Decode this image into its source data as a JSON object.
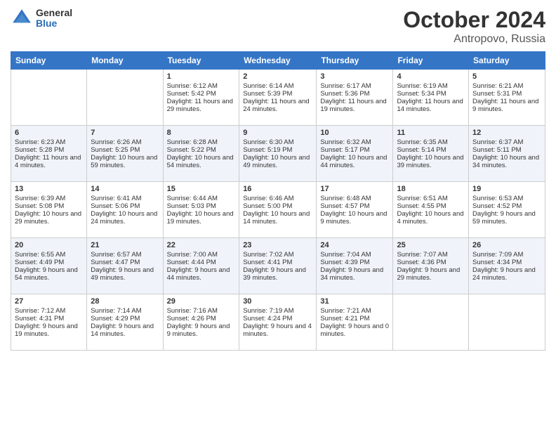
{
  "logo": {
    "general": "General",
    "blue": "Blue"
  },
  "title": {
    "month": "October 2024",
    "location": "Antropovo, Russia"
  },
  "headers": [
    "Sunday",
    "Monday",
    "Tuesday",
    "Wednesday",
    "Thursday",
    "Friday",
    "Saturday"
  ],
  "weeks": [
    [
      {
        "day": "",
        "sunrise": "",
        "sunset": "",
        "daylight": ""
      },
      {
        "day": "",
        "sunrise": "",
        "sunset": "",
        "daylight": ""
      },
      {
        "day": "1",
        "sunrise": "Sunrise: 6:12 AM",
        "sunset": "Sunset: 5:42 PM",
        "daylight": "Daylight: 11 hours and 29 minutes."
      },
      {
        "day": "2",
        "sunrise": "Sunrise: 6:14 AM",
        "sunset": "Sunset: 5:39 PM",
        "daylight": "Daylight: 11 hours and 24 minutes."
      },
      {
        "day": "3",
        "sunrise": "Sunrise: 6:17 AM",
        "sunset": "Sunset: 5:36 PM",
        "daylight": "Daylight: 11 hours and 19 minutes."
      },
      {
        "day": "4",
        "sunrise": "Sunrise: 6:19 AM",
        "sunset": "Sunset: 5:34 PM",
        "daylight": "Daylight: 11 hours and 14 minutes."
      },
      {
        "day": "5",
        "sunrise": "Sunrise: 6:21 AM",
        "sunset": "Sunset: 5:31 PM",
        "daylight": "Daylight: 11 hours and 9 minutes."
      }
    ],
    [
      {
        "day": "6",
        "sunrise": "Sunrise: 6:23 AM",
        "sunset": "Sunset: 5:28 PM",
        "daylight": "Daylight: 11 hours and 4 minutes."
      },
      {
        "day": "7",
        "sunrise": "Sunrise: 6:26 AM",
        "sunset": "Sunset: 5:25 PM",
        "daylight": "Daylight: 10 hours and 59 minutes."
      },
      {
        "day": "8",
        "sunrise": "Sunrise: 6:28 AM",
        "sunset": "Sunset: 5:22 PM",
        "daylight": "Daylight: 10 hours and 54 minutes."
      },
      {
        "day": "9",
        "sunrise": "Sunrise: 6:30 AM",
        "sunset": "Sunset: 5:19 PM",
        "daylight": "Daylight: 10 hours and 49 minutes."
      },
      {
        "day": "10",
        "sunrise": "Sunrise: 6:32 AM",
        "sunset": "Sunset: 5:17 PM",
        "daylight": "Daylight: 10 hours and 44 minutes."
      },
      {
        "day": "11",
        "sunrise": "Sunrise: 6:35 AM",
        "sunset": "Sunset: 5:14 PM",
        "daylight": "Daylight: 10 hours and 39 minutes."
      },
      {
        "day": "12",
        "sunrise": "Sunrise: 6:37 AM",
        "sunset": "Sunset: 5:11 PM",
        "daylight": "Daylight: 10 hours and 34 minutes."
      }
    ],
    [
      {
        "day": "13",
        "sunrise": "Sunrise: 6:39 AM",
        "sunset": "Sunset: 5:08 PM",
        "daylight": "Daylight: 10 hours and 29 minutes."
      },
      {
        "day": "14",
        "sunrise": "Sunrise: 6:41 AM",
        "sunset": "Sunset: 5:06 PM",
        "daylight": "Daylight: 10 hours and 24 minutes."
      },
      {
        "day": "15",
        "sunrise": "Sunrise: 6:44 AM",
        "sunset": "Sunset: 5:03 PM",
        "daylight": "Daylight: 10 hours and 19 minutes."
      },
      {
        "day": "16",
        "sunrise": "Sunrise: 6:46 AM",
        "sunset": "Sunset: 5:00 PM",
        "daylight": "Daylight: 10 hours and 14 minutes."
      },
      {
        "day": "17",
        "sunrise": "Sunrise: 6:48 AM",
        "sunset": "Sunset: 4:57 PM",
        "daylight": "Daylight: 10 hours and 9 minutes."
      },
      {
        "day": "18",
        "sunrise": "Sunrise: 6:51 AM",
        "sunset": "Sunset: 4:55 PM",
        "daylight": "Daylight: 10 hours and 4 minutes."
      },
      {
        "day": "19",
        "sunrise": "Sunrise: 6:53 AM",
        "sunset": "Sunset: 4:52 PM",
        "daylight": "Daylight: 9 hours and 59 minutes."
      }
    ],
    [
      {
        "day": "20",
        "sunrise": "Sunrise: 6:55 AM",
        "sunset": "Sunset: 4:49 PM",
        "daylight": "Daylight: 9 hours and 54 minutes."
      },
      {
        "day": "21",
        "sunrise": "Sunrise: 6:57 AM",
        "sunset": "Sunset: 4:47 PM",
        "daylight": "Daylight: 9 hours and 49 minutes."
      },
      {
        "day": "22",
        "sunrise": "Sunrise: 7:00 AM",
        "sunset": "Sunset: 4:44 PM",
        "daylight": "Daylight: 9 hours and 44 minutes."
      },
      {
        "day": "23",
        "sunrise": "Sunrise: 7:02 AM",
        "sunset": "Sunset: 4:41 PM",
        "daylight": "Daylight: 9 hours and 39 minutes."
      },
      {
        "day": "24",
        "sunrise": "Sunrise: 7:04 AM",
        "sunset": "Sunset: 4:39 PM",
        "daylight": "Daylight: 9 hours and 34 minutes."
      },
      {
        "day": "25",
        "sunrise": "Sunrise: 7:07 AM",
        "sunset": "Sunset: 4:36 PM",
        "daylight": "Daylight: 9 hours and 29 minutes."
      },
      {
        "day": "26",
        "sunrise": "Sunrise: 7:09 AM",
        "sunset": "Sunset: 4:34 PM",
        "daylight": "Daylight: 9 hours and 24 minutes."
      }
    ],
    [
      {
        "day": "27",
        "sunrise": "Sunrise: 7:12 AM",
        "sunset": "Sunset: 4:31 PM",
        "daylight": "Daylight: 9 hours and 19 minutes."
      },
      {
        "day": "28",
        "sunrise": "Sunrise: 7:14 AM",
        "sunset": "Sunset: 4:29 PM",
        "daylight": "Daylight: 9 hours and 14 minutes."
      },
      {
        "day": "29",
        "sunrise": "Sunrise: 7:16 AM",
        "sunset": "Sunset: 4:26 PM",
        "daylight": "Daylight: 9 hours and 9 minutes."
      },
      {
        "day": "30",
        "sunrise": "Sunrise: 7:19 AM",
        "sunset": "Sunset: 4:24 PM",
        "daylight": "Daylight: 9 hours and 4 minutes."
      },
      {
        "day": "31",
        "sunrise": "Sunrise: 7:21 AM",
        "sunset": "Sunset: 4:21 PM",
        "daylight": "Daylight: 9 hours and 0 minutes."
      },
      {
        "day": "",
        "sunrise": "",
        "sunset": "",
        "daylight": ""
      },
      {
        "day": "",
        "sunrise": "",
        "sunset": "",
        "daylight": ""
      }
    ]
  ]
}
